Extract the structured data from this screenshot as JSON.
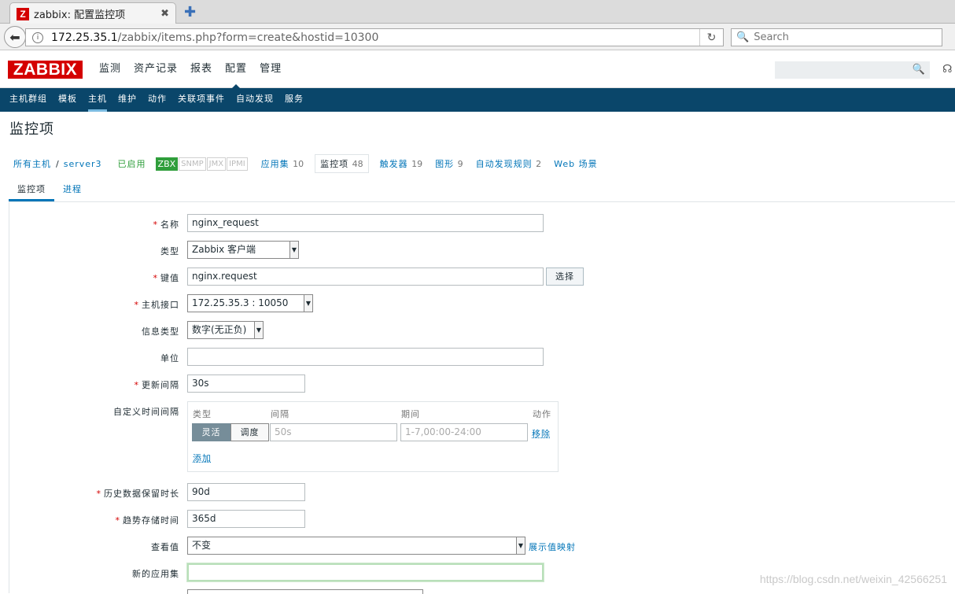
{
  "browser": {
    "tab_title": "zabbix: 配置监控项",
    "favicon_letter": "Z",
    "url_host": "172.25.35.1",
    "url_path": "/zabbix/items.php?form=create&hostid=10300",
    "search_placeholder": "Search"
  },
  "header": {
    "logo": "ZABBIX",
    "menu": [
      "监测",
      "资产记录",
      "报表",
      "配置",
      "管理"
    ],
    "active_menu": 3
  },
  "submenu": {
    "items": [
      "主机群组",
      "模板",
      "主机",
      "维护",
      "动作",
      "关联项事件",
      "自动发现",
      "服务"
    ]
  },
  "page_title": "监控项",
  "breadcrumbs": {
    "all_hosts": "所有主机",
    "separator": "/",
    "host": "server3",
    "status": "已启用",
    "badges": [
      "ZBX",
      "SNMP",
      "JMX",
      "IPMI"
    ],
    "links": [
      {
        "label": "应用集",
        "count": "10"
      },
      {
        "label": "监控项",
        "count": "48"
      },
      {
        "label": "触发器",
        "count": "19"
      },
      {
        "label": "图形",
        "count": "9"
      },
      {
        "label": "自动发现规则",
        "count": "2"
      },
      {
        "label": "Web 场景",
        "count": ""
      }
    ]
  },
  "form_tabs": [
    "监控项",
    "进程"
  ],
  "form": {
    "name_label": "名称",
    "name_value": "nginx_request",
    "type_label": "类型",
    "type_value": "Zabbix 客户端",
    "key_label": "键值",
    "key_value": "nginx.request",
    "select_button": "选择",
    "interface_label": "主机接口",
    "interface_value": "172.25.35.3 : 10050",
    "info_type_label": "信息类型",
    "info_type_value": "数字(无正负)",
    "unit_label": "单位",
    "unit_value": "",
    "interval_label": "更新间隔",
    "interval_value": "30s",
    "custom_label": "自定义时间间隔",
    "custom": {
      "col_type": "类型",
      "col_interval": "间隔",
      "col_period": "期间",
      "col_action": "动作",
      "flex": "灵活",
      "scheduling": "调度",
      "interval_placeholder": "50s",
      "period_placeholder": "1-7,00:00-24:00",
      "remove": "移除",
      "add": "添加"
    },
    "history_label": "历史数据保留时长",
    "history_value": "90d",
    "trends_label": "趋势存储时间",
    "trends_value": "365d",
    "show_value_label": "查看值",
    "show_value_value": "不变",
    "show_value_mapping": "展示值映射",
    "new_app_label": "新的应用集",
    "new_app_value": ""
  },
  "watermark": "https://blog.csdn.net/weixin_42566251"
}
